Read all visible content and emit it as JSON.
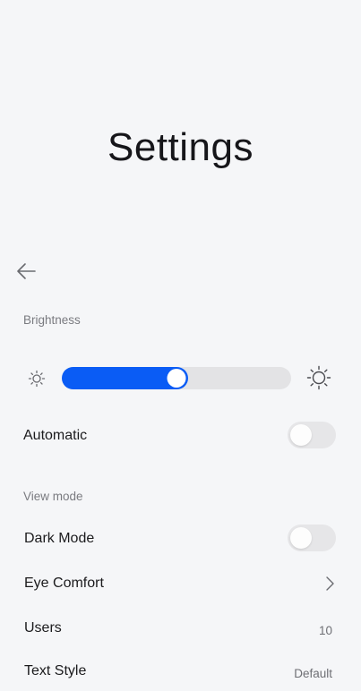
{
  "header": {
    "title": "Settings",
    "back_icon": "arrow-left-icon"
  },
  "brightness": {
    "section_label": "Brightness",
    "low_icon": "sun-small-icon",
    "high_icon": "sun-large-icon",
    "level": 0.5
  },
  "automatic": {
    "label": "Automatic",
    "enabled": false
  },
  "view_mode": {
    "section_label": "View mode",
    "dark_mode": {
      "label": "Dark Mode",
      "enabled": false
    },
    "eye_comfort": {
      "label": "Eye Comfort",
      "icon": "chevron-right-icon"
    },
    "users": {
      "label": "Users",
      "value": "10"
    },
    "text_style": {
      "label": "Text Style",
      "value": "Default"
    }
  },
  "colors": {
    "accent": "#0a5cf5",
    "background": "#f5f6f8",
    "track": "#e3e3e5"
  }
}
